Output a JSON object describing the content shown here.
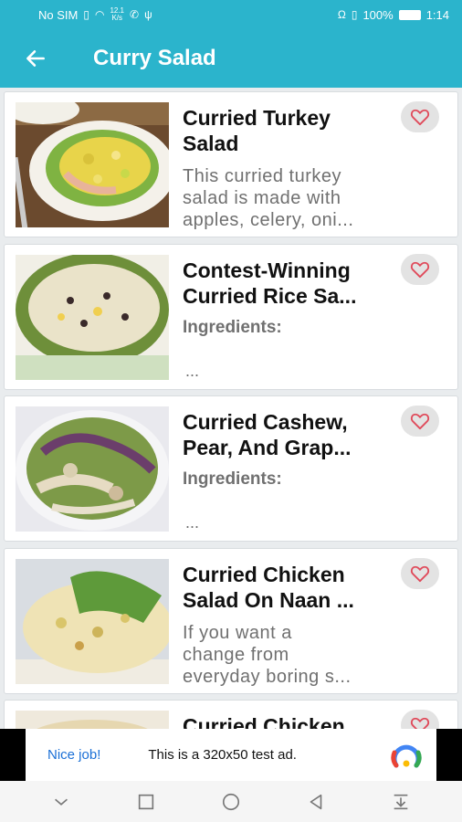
{
  "status_bar": {
    "carrier": "No SIM",
    "speed_value": "12.1",
    "speed_unit": "K/s",
    "battery": "100%",
    "time": "1:14"
  },
  "app_bar": {
    "title": "Curry Salad",
    "back_icon": "arrow-left-icon",
    "color": "#2bb4cc"
  },
  "recipes": [
    {
      "title_line1": "Curried Turkey",
      "title_line2": "Salad",
      "desc_lines": [
        "This curried turkey",
        "salad is made with",
        "apples, celery, oni..."
      ],
      "ingredients_label": "",
      "dots": ""
    },
    {
      "title_line1": "Contest-Winning",
      "title_line2": "Curried Rice Sa...",
      "desc_lines": [],
      "ingredients_label": "Ingredients:",
      "dots": "..."
    },
    {
      "title_line1": "Curried Cashew,",
      "title_line2": "Pear, And Grap...",
      "desc_lines": [],
      "ingredients_label": "Ingredients:",
      "dots": "..."
    },
    {
      "title_line1": "Curried Chicken",
      "title_line2": "Salad On Naan ...",
      "desc_lines": [
        "If you want a",
        "change from",
        "everyday boring s..."
      ],
      "ingredients_label": "",
      "dots": ""
    },
    {
      "title_line1": "Curried Chicken",
      "title_line2": "",
      "desc_lines": [],
      "ingredients_label": "",
      "dots": ""
    }
  ],
  "ad": {
    "label": "Nice job!",
    "text": "This is a 320x50 test ad."
  },
  "favorite_icon": "heart-outline-icon",
  "accent_red": "#e04a5a"
}
